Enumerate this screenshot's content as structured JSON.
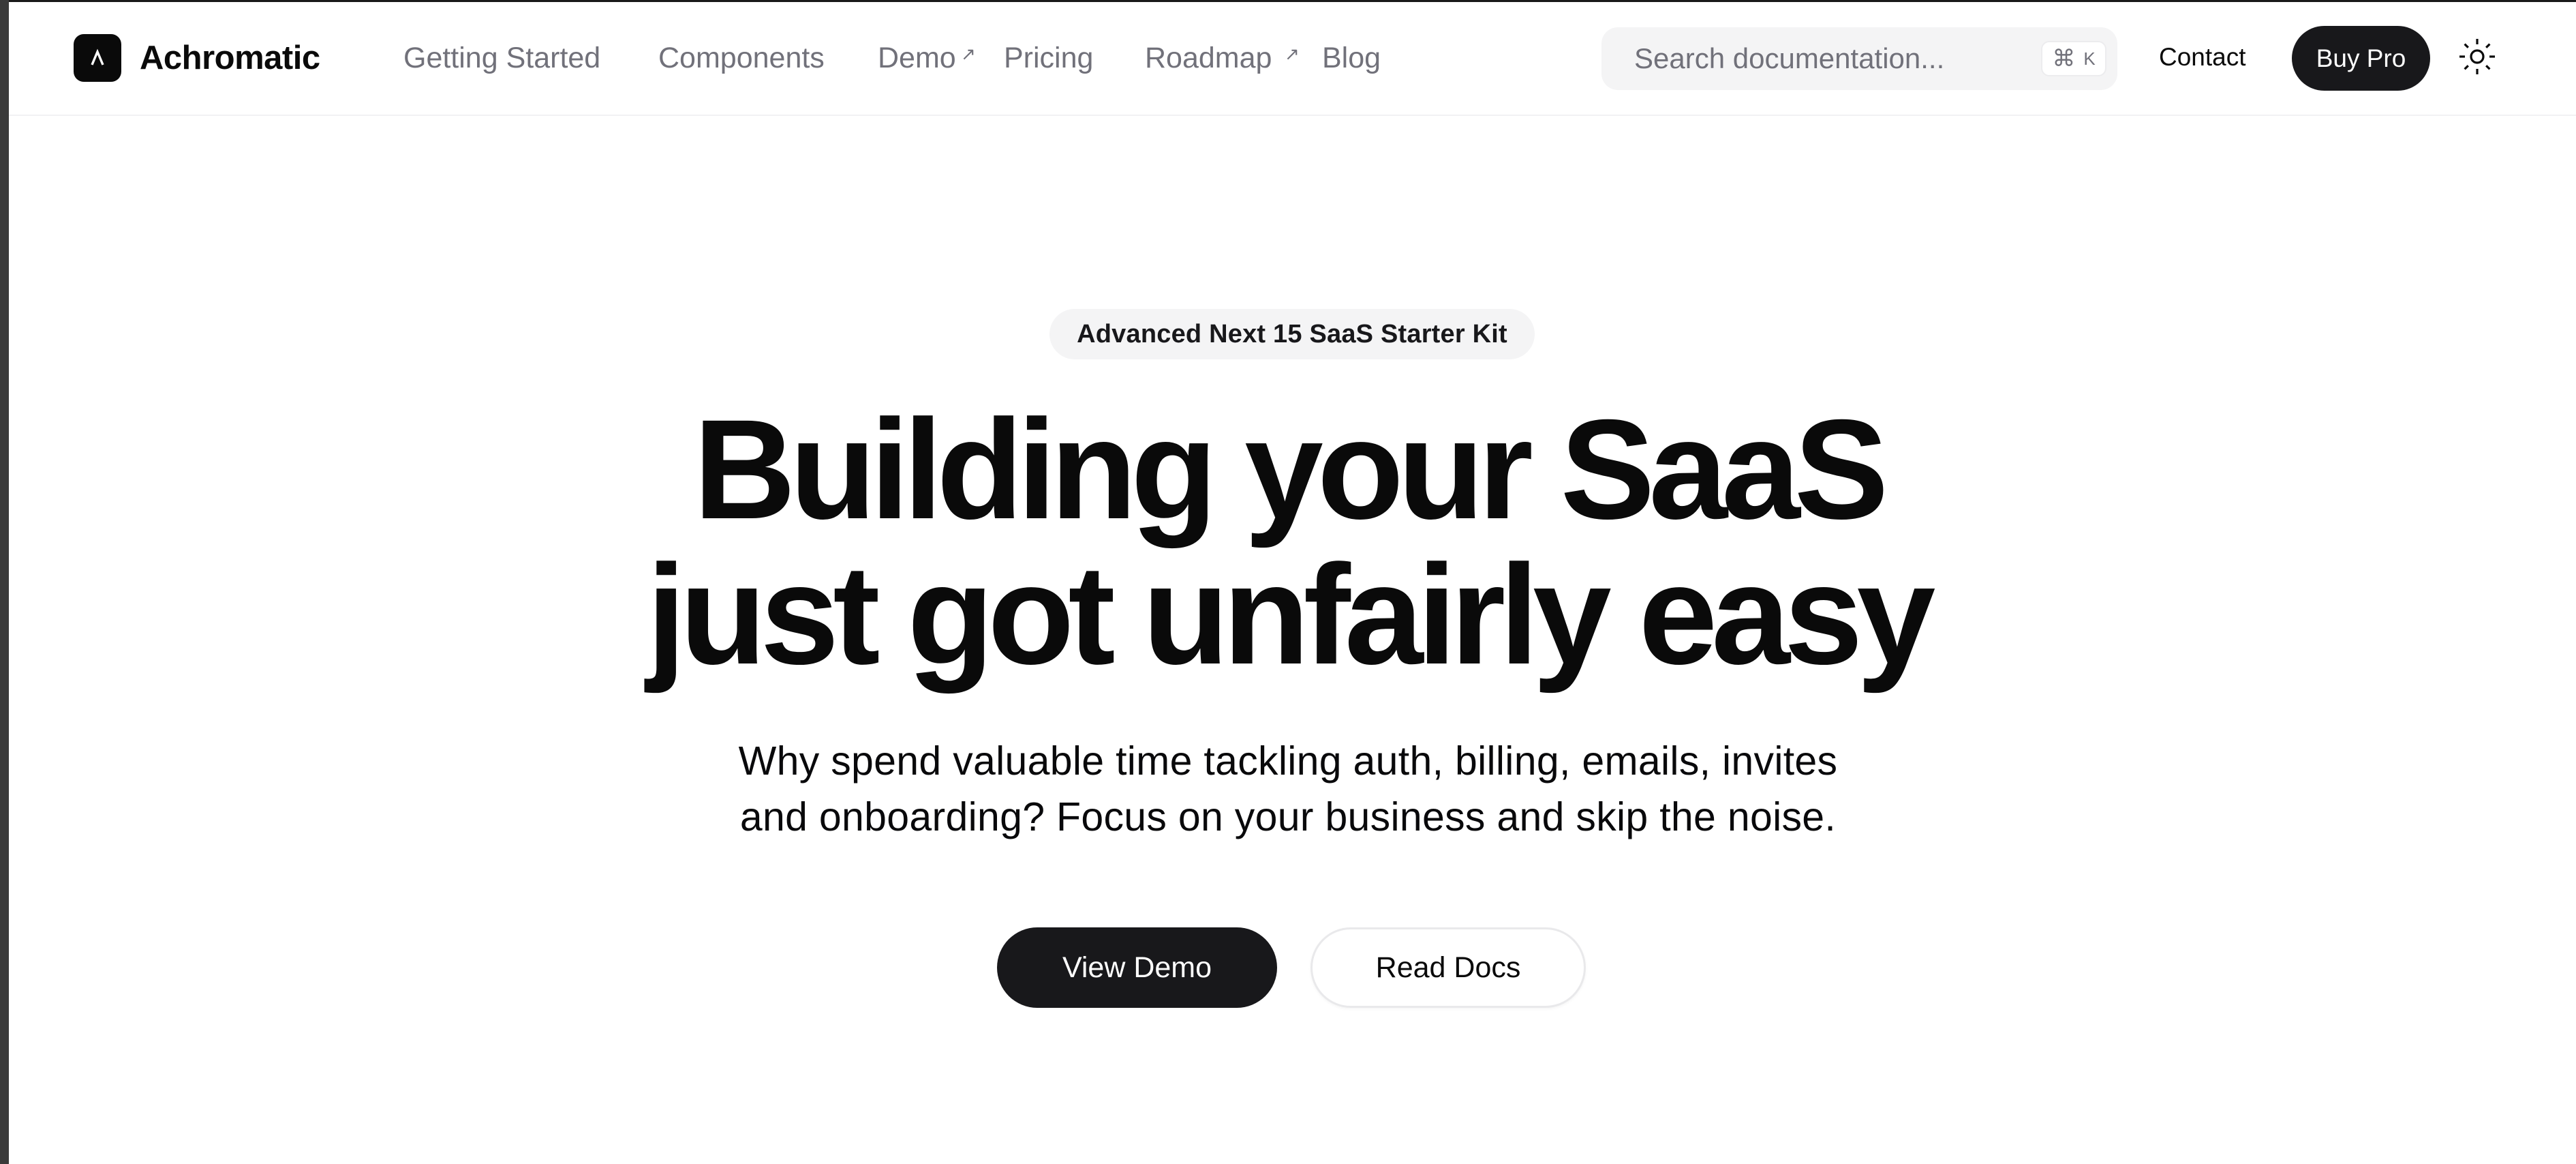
{
  "header": {
    "brand": "Achromatic",
    "logo_icon": "caret-up-logo-icon",
    "nav": [
      {
        "label": "Getting Started",
        "external": false
      },
      {
        "label": "Components",
        "external": false
      },
      {
        "label": "Demo",
        "external": true
      },
      {
        "label": "Pricing",
        "external": false
      },
      {
        "label": "Roadmap",
        "external": true
      },
      {
        "label": "Blog",
        "external": false
      }
    ],
    "external_glyph": "↗",
    "search": {
      "placeholder": "Search documentation...",
      "shortcut_cmd": "⌘",
      "shortcut_key": "K"
    },
    "contact_label": "Contact",
    "buy_label": "Buy Pro",
    "theme_icon": "sun-icon"
  },
  "hero": {
    "badge": "Advanced Next 15 SaaS Starter Kit",
    "title_line1": "Building your SaaS",
    "title_line2": "just got unfairly easy",
    "subtitle_line1": "Why spend valuable time tackling auth, billing, emails, invites",
    "subtitle_line2": "and onboarding? Focus on your business and skip the noise.",
    "primary_cta": "View Demo",
    "secondary_cta": "Read Docs"
  },
  "colors": {
    "primary": "#18181b",
    "muted_text": "#71717a",
    "muted_bg": "#f4f4f5",
    "background": "#ffffff"
  }
}
